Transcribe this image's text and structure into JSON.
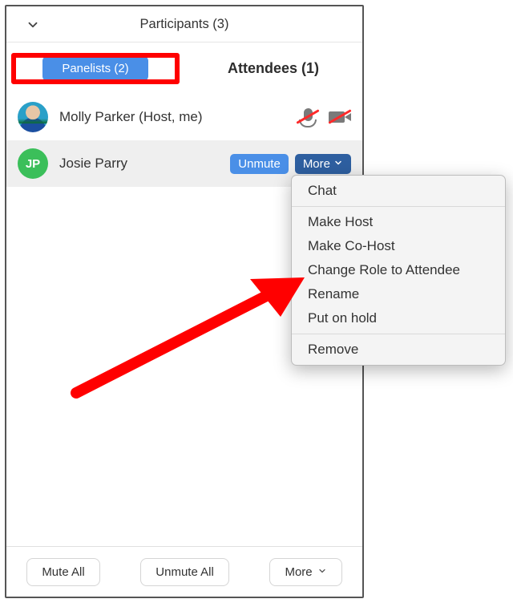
{
  "header": {
    "title": "Participants (3)"
  },
  "tabs": {
    "panelists": {
      "label": "Panelists (2)"
    },
    "attendees": {
      "label": "Attendees (1)"
    }
  },
  "participants": [
    {
      "name": "Molly Parker (Host, me)",
      "initials": ""
    },
    {
      "name": "Josie Parry",
      "initials": "JP"
    }
  ],
  "row_actions": {
    "unmute": "Unmute",
    "more": "More"
  },
  "menu": {
    "items_group1": [
      "Chat"
    ],
    "items_group2": [
      "Make Host",
      "Make Co-Host",
      "Change Role to Attendee",
      "Rename",
      "Put on hold"
    ],
    "items_group3": [
      "Remove"
    ]
  },
  "footer": {
    "mute_all": "Mute All",
    "unmute_all": "Unmute All",
    "more": "More"
  }
}
